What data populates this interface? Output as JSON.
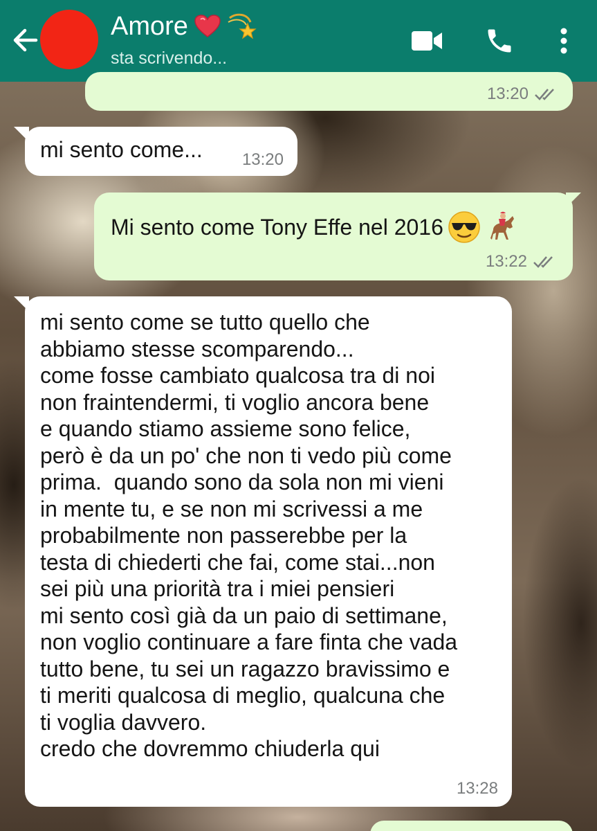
{
  "header": {
    "chat_name": "Amore",
    "status": "sta scrivendo...",
    "colors": {
      "bar": "#0b7d6c",
      "avatar": "#f22515"
    },
    "icons": [
      "back-arrow-icon",
      "video-call-icon",
      "phone-call-icon",
      "more-options-icon"
    ]
  },
  "messages": [
    {
      "direction": "out",
      "text": "",
      "time": "13:20",
      "read": true
    },
    {
      "direction": "in",
      "text": "mi sento come...",
      "time": "13:20"
    },
    {
      "direction": "out",
      "text": "Mi sento come Tony Effe nel 2016",
      "emojis": [
        "smiling-face-with-sunglasses",
        "horse-racing"
      ],
      "time": "13:22",
      "read": true
    },
    {
      "direction": "in",
      "text": "mi sento come se tutto quello che\nabbiamo stesse scomparendo...\ncome fosse cambiato qualcosa tra di noi\nnon fraintendermi, ti voglio ancora bene\ne quando stiamo assieme sono felice,\nperò è da un po' che non ti vedo più come\nprima.  quando sono da sola non mi vieni\nin mente tu, e se non mi scrivessi a me\nprobabilmente non passerebbe per la\ntesta di chiederti che fai, come stai...non\nsei più una priorità tra i miei pensieri\nmi sento così già da un paio di settimane,\nnon voglio continuare a fare finta che vada\ntutto bene, tu sei un ragazzo bravissimo e\nti meriti qualcosa di meglio, qualcuna che\nti voglia davvero.\ncredo che dovremmo chiuderla qui",
      "time": "13:28"
    }
  ],
  "colors": {
    "outgoing_bubble": "#e4fbd3",
    "incoming_bubble": "#ffffff",
    "timestamp": "#7a7d7e"
  }
}
